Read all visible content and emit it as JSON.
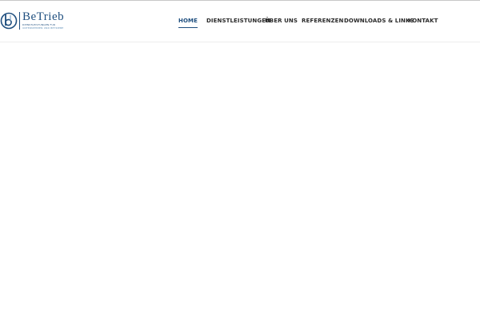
{
  "brand": {
    "name": "BeTrieb",
    "tagline_line1": "DIENSTLEISTUNGEN FÜR",
    "tagline_line2": "UNTERNEHMEN UND BETRIEBE",
    "color": "#1f4f7f"
  },
  "nav": {
    "items": [
      {
        "label": "HOME",
        "active": true
      },
      {
        "label": "DIENSTLEISTUNGEN",
        "active": false
      },
      {
        "label": "ÜBER UNS",
        "active": false
      },
      {
        "label": "REFERENZEN",
        "active": false
      },
      {
        "label": "DOWNLOADS & LINKS",
        "active": false
      },
      {
        "label": "KONTAKT",
        "active": false
      }
    ],
    "active_color": "#1f4f7f",
    "text_color": "#2b2b2b"
  }
}
